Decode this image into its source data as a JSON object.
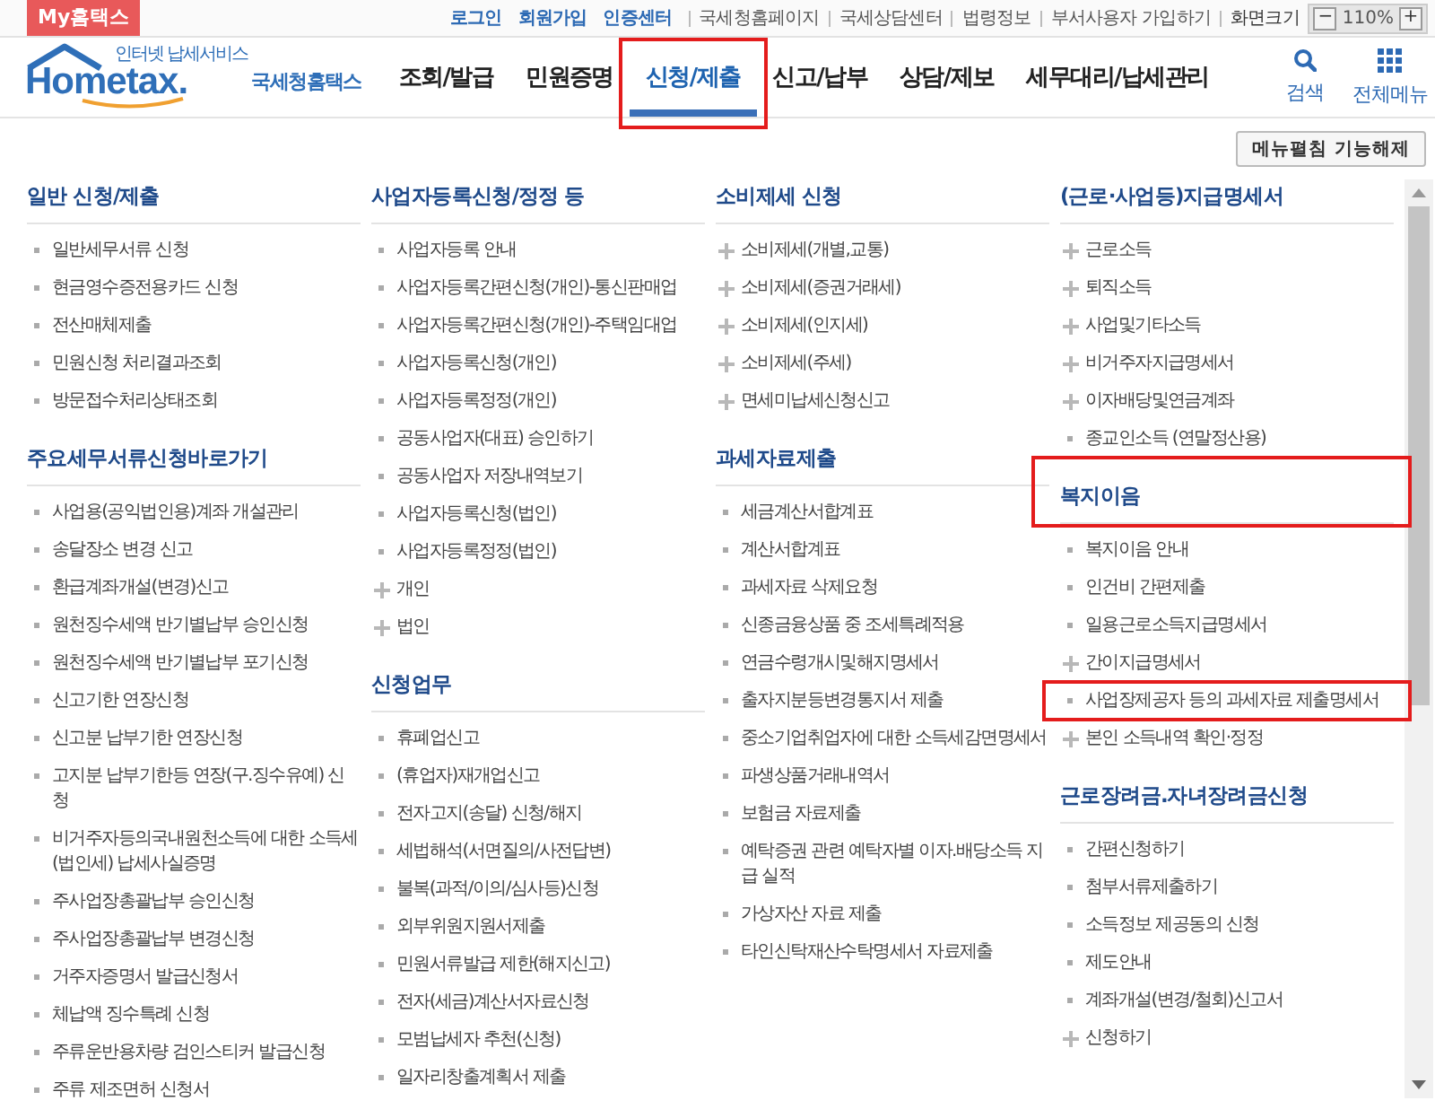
{
  "top_bar": {
    "my_button": "My홈택스",
    "links": [
      {
        "label": "로그인",
        "kind": "account"
      },
      {
        "label": "회원가입",
        "kind": "account"
      },
      {
        "label": "인증센터",
        "kind": "account"
      },
      {
        "label": "국세청홈페이지",
        "kind": "plain"
      },
      {
        "label": "국세상담센터",
        "kind": "plain"
      },
      {
        "label": "법령정보",
        "kind": "plain"
      },
      {
        "label": "부서사용자 가입하기",
        "kind": "plain"
      }
    ],
    "zoom": {
      "label": "화면크기",
      "minus": "−",
      "value": "110%",
      "plus": "+"
    }
  },
  "header": {
    "logo": {
      "tagline": "인터넷 납세서비스",
      "wordmark": "Hometax.",
      "name": "국세청홈택스"
    },
    "nav": [
      {
        "label": "조회/발급",
        "selected": false,
        "highlighted": false
      },
      {
        "label": "민원증명",
        "selected": false,
        "highlighted": false
      },
      {
        "label": "신청/제출",
        "selected": true,
        "highlighted": true
      },
      {
        "label": "신고/납부",
        "selected": false,
        "highlighted": false
      },
      {
        "label": "상담/제보",
        "selected": false,
        "highlighted": false
      },
      {
        "label": "세무대리/납세관리",
        "selected": false,
        "highlighted": false
      }
    ],
    "tools": [
      {
        "label": "검색",
        "kind": "search"
      },
      {
        "label": "전체메뉴",
        "kind": "all-menu"
      }
    ]
  },
  "menu_toggle": "메뉴펼침 기능해제",
  "columns": [
    {
      "sections": [
        {
          "title": "일반 신청/제출",
          "highlighted": false,
          "items": [
            {
              "label": "일반세무서류 신청",
              "kind": "dot",
              "highlighted": false
            },
            {
              "label": "현금영수증전용카드 신청",
              "kind": "dot",
              "highlighted": false
            },
            {
              "label": "전산매체제출",
              "kind": "dot",
              "highlighted": false
            },
            {
              "label": "민원신청 처리결과조회",
              "kind": "dot",
              "highlighted": false
            },
            {
              "label": "방문접수처리상태조회",
              "kind": "dot",
              "highlighted": false
            }
          ]
        },
        {
          "title": "주요세무서류신청바로가기",
          "highlighted": false,
          "items": [
            {
              "label": "사업용(공익법인용)계좌 개설관리",
              "kind": "dot",
              "highlighted": false
            },
            {
              "label": "송달장소 변경 신고",
              "kind": "dot",
              "highlighted": false
            },
            {
              "label": "환급계좌개설(변경)신고",
              "kind": "dot",
              "highlighted": false
            },
            {
              "label": "원천징수세액 반기별납부 승인신청",
              "kind": "dot",
              "highlighted": false
            },
            {
              "label": "원천징수세액 반기별납부 포기신청",
              "kind": "dot",
              "highlighted": false
            },
            {
              "label": "신고기한 연장신청",
              "kind": "dot",
              "highlighted": false
            },
            {
              "label": "신고분 납부기한 연장신청",
              "kind": "dot",
              "highlighted": false
            },
            {
              "label": "고지분 납부기한등 연장(구.징수유예) 신청",
              "kind": "dot",
              "highlighted": false
            },
            {
              "label": "비거주자등의국내원천소득에 대한 소득세(법인세) 납세사실증명",
              "kind": "dot",
              "highlighted": false
            },
            {
              "label": "주사업장총괄납부 승인신청",
              "kind": "dot",
              "highlighted": false
            },
            {
              "label": "주사업장총괄납부 변경신청",
              "kind": "dot",
              "highlighted": false
            },
            {
              "label": "거주자증명서 발급신청서",
              "kind": "dot",
              "highlighted": false
            },
            {
              "label": "체납액 징수특례 신청",
              "kind": "dot",
              "highlighted": false
            },
            {
              "label": "주류운반용차량 검인스티커 발급신청",
              "kind": "dot",
              "highlighted": false
            },
            {
              "label": "주류 제조면허 신청서",
              "kind": "dot",
              "highlighted": false
            }
          ]
        }
      ]
    },
    {
      "sections": [
        {
          "title": "사업자등록신청/정정 등",
          "highlighted": false,
          "items": [
            {
              "label": "사업자등록 안내",
              "kind": "dot",
              "highlighted": false
            },
            {
              "label": "사업자등록간편신청(개인)-통신판매업",
              "kind": "dot",
              "highlighted": false
            },
            {
              "label": "사업자등록간편신청(개인)-주택임대업",
              "kind": "dot",
              "highlighted": false
            },
            {
              "label": "사업자등록신청(개인)",
              "kind": "dot",
              "highlighted": false
            },
            {
              "label": "사업자등록정정(개인)",
              "kind": "dot",
              "highlighted": false
            },
            {
              "label": "공동사업자(대표) 승인하기",
              "kind": "dot",
              "highlighted": false
            },
            {
              "label": "공동사업자 저장내역보기",
              "kind": "dot",
              "highlighted": false
            },
            {
              "label": "사업자등록신청(법인)",
              "kind": "dot",
              "highlighted": false
            },
            {
              "label": "사업자등록정정(법인)",
              "kind": "dot",
              "highlighted": false
            },
            {
              "label": "개인",
              "kind": "plus",
              "highlighted": false
            },
            {
              "label": "법인",
              "kind": "plus",
              "highlighted": false
            }
          ]
        },
        {
          "title": "신청업무",
          "highlighted": false,
          "items": [
            {
              "label": "휴폐업신고",
              "kind": "dot",
              "highlighted": false
            },
            {
              "label": "(휴업자)재개업신고",
              "kind": "dot",
              "highlighted": false
            },
            {
              "label": "전자고지(송달) 신청/해지",
              "kind": "dot",
              "highlighted": false
            },
            {
              "label": "세법해석(서면질의/사전답변)",
              "kind": "dot",
              "highlighted": false
            },
            {
              "label": "불복(과적/이의/심사등)신청",
              "kind": "dot",
              "highlighted": false
            },
            {
              "label": "외부위원지원서제출",
              "kind": "dot",
              "highlighted": false
            },
            {
              "label": "민원서류발급 제한(해지신고)",
              "kind": "dot",
              "highlighted": false
            },
            {
              "label": "전자(세금)계산서자료신청",
              "kind": "dot",
              "highlighted": false
            },
            {
              "label": "모범납세자 추천(신청)",
              "kind": "dot",
              "highlighted": false
            },
            {
              "label": "일자리창출계획서 제출",
              "kind": "dot",
              "highlighted": false
            }
          ]
        }
      ]
    },
    {
      "sections": [
        {
          "title": "소비제세 신청",
          "highlighted": false,
          "items": [
            {
              "label": "소비제세(개별,교통)",
              "kind": "plus",
              "highlighted": false
            },
            {
              "label": "소비제세(증권거래세)",
              "kind": "plus",
              "highlighted": false
            },
            {
              "label": "소비제세(인지세)",
              "kind": "plus",
              "highlighted": false
            },
            {
              "label": "소비제세(주세)",
              "kind": "plus",
              "highlighted": false
            },
            {
              "label": "면세미납세신청신고",
              "kind": "plus",
              "highlighted": false
            }
          ]
        },
        {
          "title": "과세자료제출",
          "highlighted": false,
          "items": [
            {
              "label": "세금계산서합계표",
              "kind": "dot",
              "highlighted": false
            },
            {
              "label": "계산서합계표",
              "kind": "dot",
              "highlighted": false
            },
            {
              "label": "과세자료 삭제요청",
              "kind": "dot",
              "highlighted": false
            },
            {
              "label": "신종금융상품 중 조세특례적용",
              "kind": "dot",
              "highlighted": false
            },
            {
              "label": "연금수령개시및해지명세서",
              "kind": "dot",
              "highlighted": false
            },
            {
              "label": "출자지분등변경통지서 제출",
              "kind": "dot",
              "highlighted": false
            },
            {
              "label": "중소기업취업자에 대한 소득세감면명세서",
              "kind": "dot",
              "highlighted": false
            },
            {
              "label": "파생상품거래내역서",
              "kind": "dot",
              "highlighted": false
            },
            {
              "label": "보험금 자료제출",
              "kind": "dot",
              "highlighted": false
            },
            {
              "label": "예탁증권 관련 예탁자별 이자.배당소득 지급 실적",
              "kind": "dot",
              "highlighted": false
            },
            {
              "label": "가상자산 자료 제출",
              "kind": "dot",
              "highlighted": false
            },
            {
              "label": "타인신탁재산수탁명세서 자료제출",
              "kind": "dot",
              "highlighted": false
            }
          ]
        }
      ]
    },
    {
      "sections": [
        {
          "title": "(근로·사업등)지급명세서",
          "highlighted": false,
          "items": [
            {
              "label": "근로소득",
              "kind": "plus",
              "highlighted": false
            },
            {
              "label": "퇴직소득",
              "kind": "plus",
              "highlighted": false
            },
            {
              "label": "사업및기타소득",
              "kind": "plus",
              "highlighted": false
            },
            {
              "label": "비거주자지급명세서",
              "kind": "plus",
              "highlighted": false
            },
            {
              "label": "이자배당및연금계좌",
              "kind": "plus",
              "highlighted": false
            },
            {
              "label": "종교인소득 (연말정산용)",
              "kind": "dot",
              "highlighted": false
            }
          ]
        },
        {
          "title": "복지이음",
          "highlighted": true,
          "items": [
            {
              "label": "복지이음 안내",
              "kind": "dot",
              "highlighted": false
            },
            {
              "label": "인건비 간편제출",
              "kind": "dot",
              "highlighted": false
            },
            {
              "label": "일용근로소득지급명세서",
              "kind": "dot",
              "highlighted": false
            },
            {
              "label": "간이지급명세서",
              "kind": "plus",
              "highlighted": false
            },
            {
              "label": "사업장제공자 등의 과세자료 제출명세서",
              "kind": "dot",
              "highlighted": true
            },
            {
              "label": "본인 소득내역 확인·정정",
              "kind": "plus",
              "highlighted": false
            }
          ]
        },
        {
          "title": "근로장려금.자녀장려금신청",
          "highlighted": false,
          "items": [
            {
              "label": "간편신청하기",
              "kind": "dot",
              "highlighted": false
            },
            {
              "label": "첨부서류제출하기",
              "kind": "dot",
              "highlighted": false
            },
            {
              "label": "소득정보 제공동의 신청",
              "kind": "dot",
              "highlighted": false
            },
            {
              "label": "제도안내",
              "kind": "dot",
              "highlighted": false
            },
            {
              "label": "계좌개설(변경/철회)신고서",
              "kind": "dot",
              "highlighted": false
            },
            {
              "label": "신청하기",
              "kind": "plus",
              "highlighted": false
            }
          ]
        }
      ]
    }
  ]
}
